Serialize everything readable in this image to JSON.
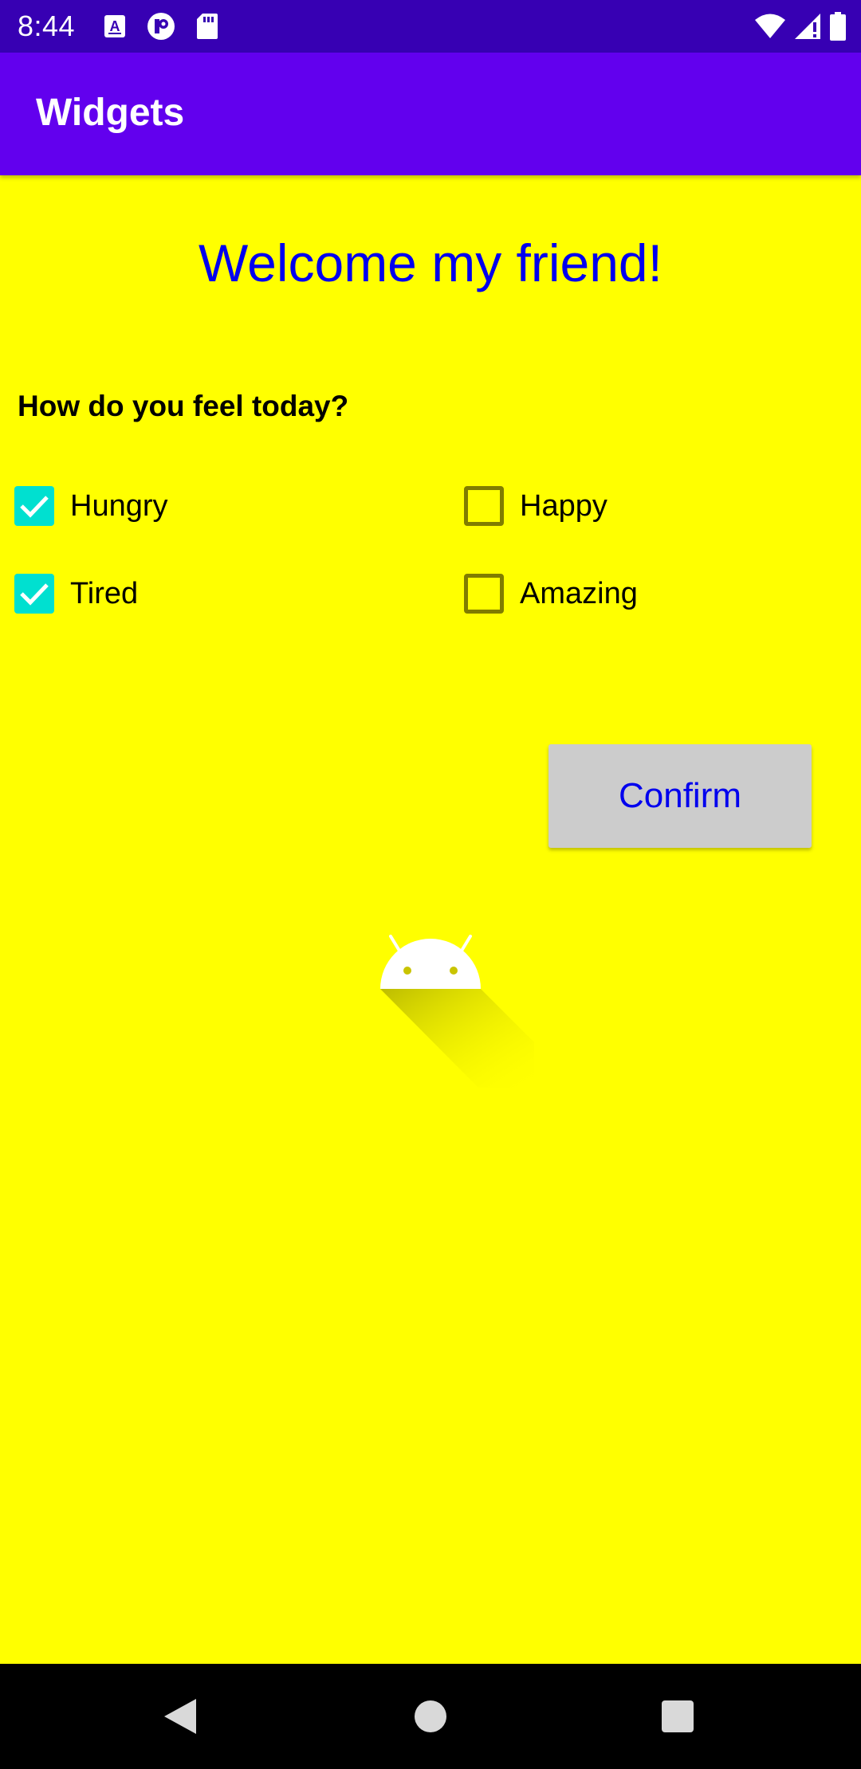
{
  "status_bar": {
    "time": "8:44",
    "left_icons": [
      "a-notification-icon",
      "circle-p-notification-icon",
      "sd-card-icon"
    ],
    "right_icons": [
      "wifi-icon",
      "signal-icon",
      "battery-icon"
    ]
  },
  "app_bar": {
    "title": "Widgets",
    "color": "#6200ee"
  },
  "main": {
    "background": "#ffff00",
    "welcome": "Welcome my friend!",
    "question": "How do you feel today?",
    "checkboxes": [
      {
        "label": "Hungry",
        "checked": true
      },
      {
        "label": "Happy",
        "checked": false
      },
      {
        "label": "Tired",
        "checked": true
      },
      {
        "label": "Amazing",
        "checked": false
      }
    ],
    "confirm_label": "Confirm",
    "image_icon": "android-icon"
  },
  "nav_bar": {
    "buttons": [
      "back-icon",
      "home-icon",
      "recents-icon"
    ]
  }
}
